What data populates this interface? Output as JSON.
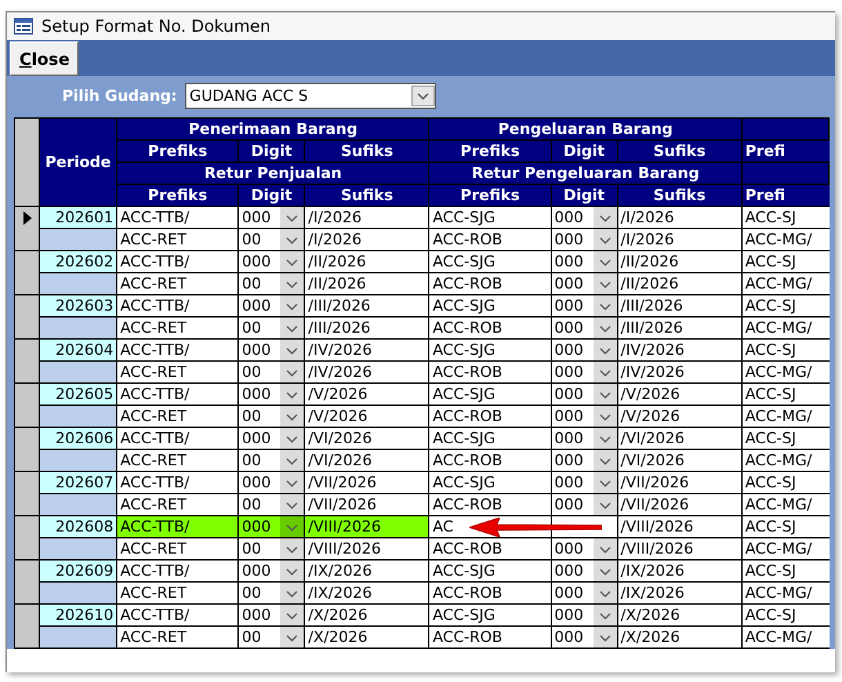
{
  "window": {
    "title": "Setup Format No. Dokumen"
  },
  "toolbar": {
    "close_button": "Close"
  },
  "filter": {
    "label": "Pilih Gudang:",
    "value": "GUDANG ACC S"
  },
  "grid": {
    "period_header": "Periode",
    "groups": [
      {
        "title": "Penerimaan Barang",
        "return_title": "Retur Penjualan",
        "columns": [
          "Prefiks",
          "Digit",
          "Sufiks"
        ],
        "return_columns": [
          "Prefiks",
          "Digit",
          "Sufiks"
        ]
      },
      {
        "title": "Pengeluaran Barang",
        "return_title": "Retur Pengeluaran Barang",
        "columns": [
          "Prefiks",
          "Digit",
          "Sufiks"
        ],
        "return_columns": [
          "Prefiks",
          "Digit",
          "Sufiks"
        ]
      },
      {
        "columns": [
          "Prefi"
        ],
        "return_columns": [
          "Prefi"
        ]
      }
    ],
    "rows": [
      {
        "periode": "202601",
        "current": true,
        "highlighted": false,
        "main": [
          {
            "prefiks": "ACC-TTB/",
            "digit": "000",
            "sufiks": "/I/2026"
          },
          {
            "prefiks": "ACC-SJG",
            "digit": "000",
            "sufiks": "/I/2026"
          },
          {
            "prefiks": "ACC-SJ"
          }
        ],
        "retur": [
          {
            "prefiks": "ACC-RET",
            "digit": "00",
            "sufiks": "/I/2026"
          },
          {
            "prefiks": "ACC-ROB",
            "digit": "000",
            "sufiks": "/I/2026"
          },
          {
            "prefiks": "ACC-MG/"
          }
        ]
      },
      {
        "periode": "202602",
        "current": false,
        "highlighted": false,
        "main": [
          {
            "prefiks": "ACC-TTB/",
            "digit": "000",
            "sufiks": "/II/2026"
          },
          {
            "prefiks": "ACC-SJG",
            "digit": "000",
            "sufiks": "/II/2026"
          },
          {
            "prefiks": "ACC-SJ"
          }
        ],
        "retur": [
          {
            "prefiks": "ACC-RET",
            "digit": "00",
            "sufiks": "/II/2026"
          },
          {
            "prefiks": "ACC-ROB",
            "digit": "000",
            "sufiks": "/II/2026"
          },
          {
            "prefiks": "ACC-MG/"
          }
        ]
      },
      {
        "periode": "202603",
        "current": false,
        "highlighted": false,
        "main": [
          {
            "prefiks": "ACC-TTB/",
            "digit": "000",
            "sufiks": "/III/2026"
          },
          {
            "prefiks": "ACC-SJG",
            "digit": "000",
            "sufiks": "/III/2026"
          },
          {
            "prefiks": "ACC-SJ"
          }
        ],
        "retur": [
          {
            "prefiks": "ACC-RET",
            "digit": "00",
            "sufiks": "/III/2026"
          },
          {
            "prefiks": "ACC-ROB",
            "digit": "000",
            "sufiks": "/III/2026"
          },
          {
            "prefiks": "ACC-MG/"
          }
        ]
      },
      {
        "periode": "202604",
        "current": false,
        "highlighted": false,
        "main": [
          {
            "prefiks": "ACC-TTB/",
            "digit": "000",
            "sufiks": "/IV/2026"
          },
          {
            "prefiks": "ACC-SJG",
            "digit": "000",
            "sufiks": "/IV/2026"
          },
          {
            "prefiks": "ACC-SJ"
          }
        ],
        "retur": [
          {
            "prefiks": "ACC-RET",
            "digit": "00",
            "sufiks": "/IV/2026"
          },
          {
            "prefiks": "ACC-ROB",
            "digit": "000",
            "sufiks": "/IV/2026"
          },
          {
            "prefiks": "ACC-MG/"
          }
        ]
      },
      {
        "periode": "202605",
        "current": false,
        "highlighted": false,
        "main": [
          {
            "prefiks": "ACC-TTB/",
            "digit": "000",
            "sufiks": "/V/2026"
          },
          {
            "prefiks": "ACC-SJG",
            "digit": "000",
            "sufiks": "/V/2026"
          },
          {
            "prefiks": "ACC-SJ"
          }
        ],
        "retur": [
          {
            "prefiks": "ACC-RET",
            "digit": "00",
            "sufiks": "/V/2026"
          },
          {
            "prefiks": "ACC-ROB",
            "digit": "000",
            "sufiks": "/V/2026"
          },
          {
            "prefiks": "ACC-MG/"
          }
        ]
      },
      {
        "periode": "202606",
        "current": false,
        "highlighted": false,
        "main": [
          {
            "prefiks": "ACC-TTB/",
            "digit": "000",
            "sufiks": "/VI/2026"
          },
          {
            "prefiks": "ACC-SJG",
            "digit": "000",
            "sufiks": "/VI/2026"
          },
          {
            "prefiks": "ACC-SJ"
          }
        ],
        "retur": [
          {
            "prefiks": "ACC-RET",
            "digit": "00",
            "sufiks": "/VI/2026"
          },
          {
            "prefiks": "ACC-ROB",
            "digit": "000",
            "sufiks": "/VI/2026"
          },
          {
            "prefiks": "ACC-MG/"
          }
        ]
      },
      {
        "periode": "202607",
        "current": false,
        "highlighted": false,
        "main": [
          {
            "prefiks": "ACC-TTB/",
            "digit": "000",
            "sufiks": "/VII/2026"
          },
          {
            "prefiks": "ACC-SJG",
            "digit": "000",
            "sufiks": "/VII/2026"
          },
          {
            "prefiks": "ACC-SJ"
          }
        ],
        "retur": [
          {
            "prefiks": "ACC-RET",
            "digit": "00",
            "sufiks": "/VII/2026"
          },
          {
            "prefiks": "ACC-ROB",
            "digit": "000",
            "sufiks": "/VII/2026"
          },
          {
            "prefiks": "ACC-MG/"
          }
        ]
      },
      {
        "periode": "202608",
        "current": false,
        "highlighted": true,
        "main": [
          {
            "prefiks": "ACC-TTB/",
            "digit": "000",
            "sufiks": "/VIII/2026"
          },
          {
            "prefiks": "AC",
            "sufiks": "/VIII/2026"
          },
          {
            "prefiks": "ACC-SJ"
          }
        ],
        "retur": [
          {
            "prefiks": "ACC-RET",
            "digit": "00",
            "sufiks": "/VIII/2026"
          },
          {
            "prefiks": "ACC-ROB",
            "digit": "000",
            "sufiks": "/VIII/2026"
          },
          {
            "prefiks": "ACC-MG/"
          }
        ]
      },
      {
        "periode": "202609",
        "current": false,
        "highlighted": false,
        "main": [
          {
            "prefiks": "ACC-TTB/",
            "digit": "000",
            "sufiks": "/IX/2026"
          },
          {
            "prefiks": "ACC-SJG",
            "digit": "000",
            "sufiks": "/IX/2026"
          },
          {
            "prefiks": "ACC-SJ"
          }
        ],
        "retur": [
          {
            "prefiks": "ACC-RET",
            "digit": "00",
            "sufiks": "/IX/2026"
          },
          {
            "prefiks": "ACC-ROB",
            "digit": "000",
            "sufiks": "/IX/2026"
          },
          {
            "prefiks": "ACC-MG/"
          }
        ]
      },
      {
        "periode": "202610",
        "current": false,
        "highlighted": false,
        "main": [
          {
            "prefiks": "ACC-TTB/",
            "digit": "000",
            "sufiks": "/X/2026"
          },
          {
            "prefiks": "ACC-SJG",
            "digit": "000",
            "sufiks": "/X/2026"
          },
          {
            "prefiks": "ACC-SJ"
          }
        ],
        "retur": [
          {
            "prefiks": "ACC-RET",
            "digit": "00",
            "sufiks": "/X/2026"
          },
          {
            "prefiks": "ACC-ROB",
            "digit": "000",
            "sufiks": "/X/2026"
          },
          {
            "prefiks": "ACC-MG/"
          }
        ]
      }
    ]
  }
}
